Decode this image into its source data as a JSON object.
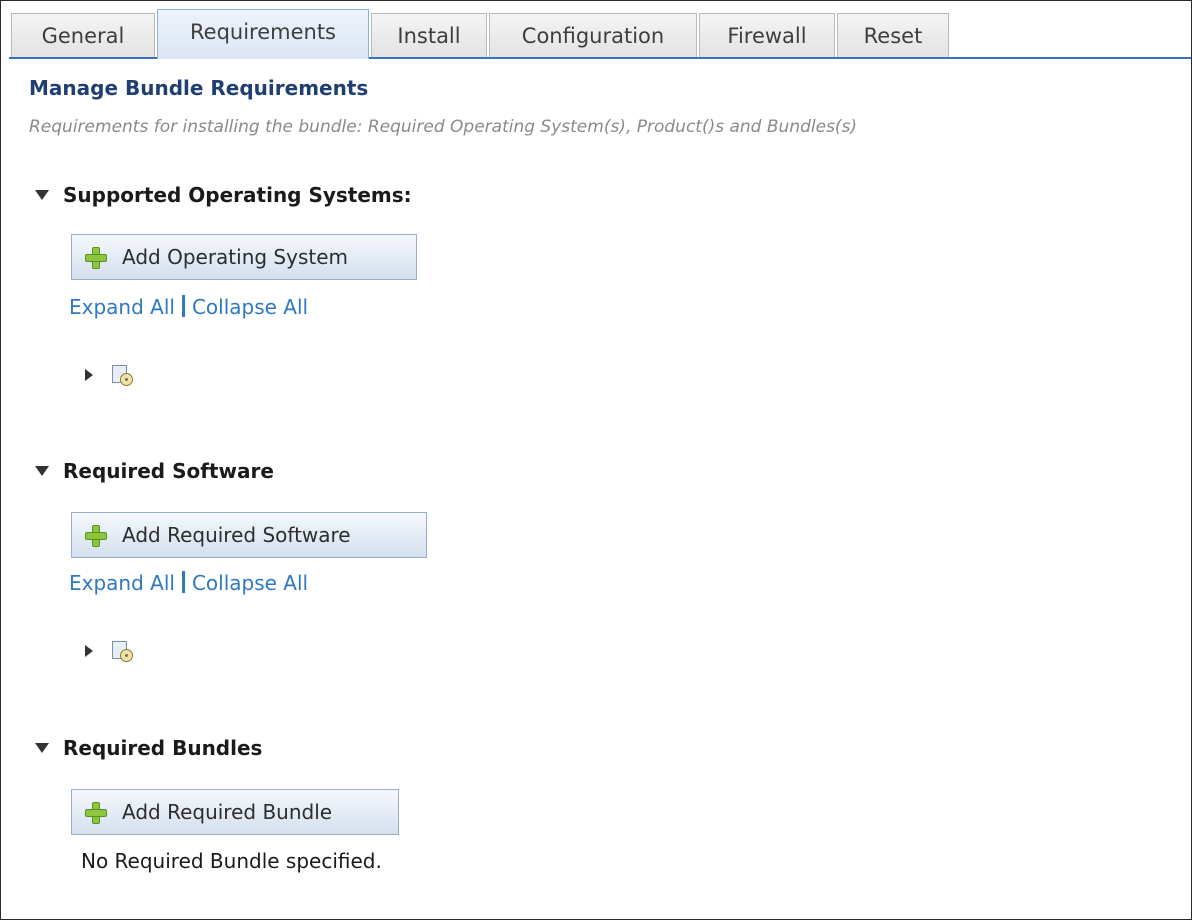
{
  "tabs": [
    {
      "label": "General",
      "active": false
    },
    {
      "label": "Requirements",
      "active": true
    },
    {
      "label": "Install",
      "active": false
    },
    {
      "label": "Configuration",
      "active": false
    },
    {
      "label": "Firewall",
      "active": false
    },
    {
      "label": "Reset",
      "active": false
    }
  ],
  "header": {
    "title": "Manage Bundle Requirements",
    "subtitle": "Requirements for installing the bundle: Required Operating System(s), Product()s and Bundles(s)"
  },
  "sections": {
    "os": {
      "heading": "Supported Operating Systems:",
      "button_label": "Add Operating System",
      "expand_all": "Expand All",
      "collapse_all": "Collapse All"
    },
    "software": {
      "heading": "Required Software",
      "button_label": "Add Required Software",
      "expand_all": "Expand All",
      "collapse_all": "Collapse All"
    },
    "bundles": {
      "heading": "Required Bundles",
      "button_label": "Add Required Bundle",
      "empty_message": "No Required Bundle specified."
    }
  },
  "icons": {
    "section_toggle": "chevron-down-icon",
    "node_toggle": "chevron-right-icon",
    "add": "plus-icon",
    "os_node": "operating-system-icon",
    "software_node": "software-disc-icon"
  },
  "colors": {
    "title": "#1f3f73",
    "link": "#2f78c4",
    "tab_accent": "#3a72c0",
    "plus_green": "#8cc63f"
  }
}
